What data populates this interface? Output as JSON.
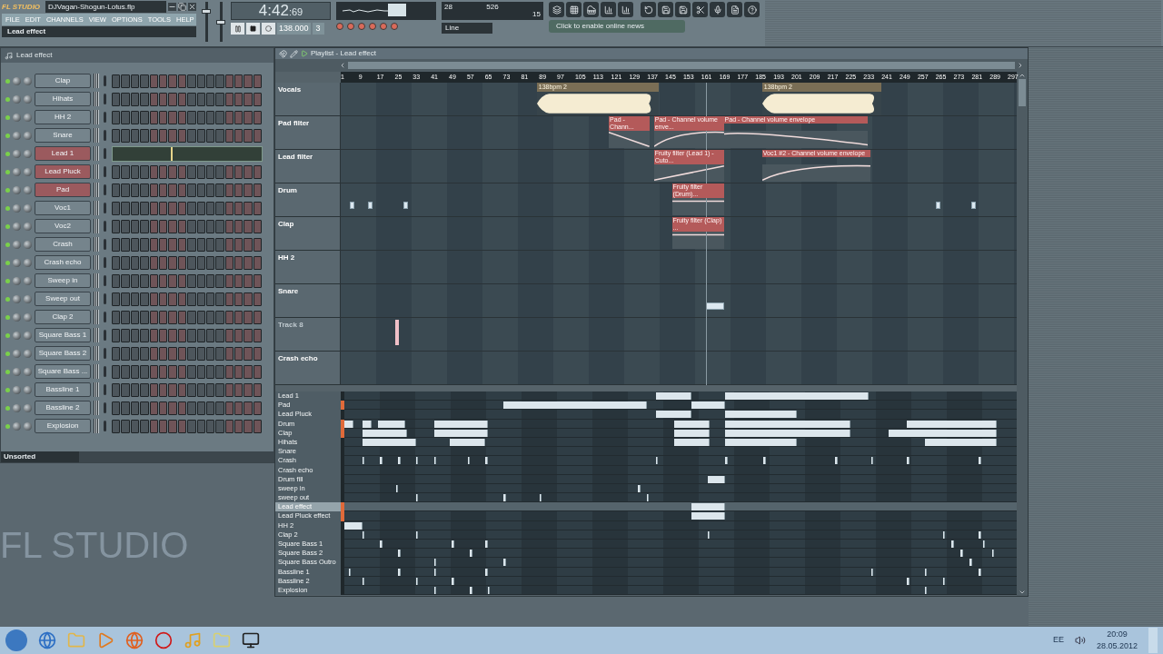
{
  "app": {
    "logo": "FL STUDIO",
    "file_name": "DJVagan-Shogun-Lotus.flp",
    "menu": [
      "FILE",
      "EDIT",
      "CHANNELS",
      "VIEW",
      "OPTIONS",
      "TOOLS",
      "HELP"
    ],
    "hint": "Lead effect",
    "time": "4:42",
    "time_frac": ":69",
    "tempo": "138.000",
    "pattern": "3",
    "snap": "Line",
    "cpu": "28",
    "memory": "526",
    "polyphony": "15",
    "news": "Click to enable online news",
    "master_volume": {
      "level": 0.8
    },
    "master_pitch": {
      "level": 0.5
    }
  },
  "channel_rack": {
    "title": "Lead effect",
    "filter": "Unsorted",
    "channels": [
      {
        "name": "Clap",
        "selected": false,
        "kind": "steps"
      },
      {
        "name": "Hihats",
        "selected": false,
        "kind": "steps"
      },
      {
        "name": "HH 2",
        "selected": false,
        "kind": "steps"
      },
      {
        "name": "Snare",
        "selected": false,
        "kind": "steps"
      },
      {
        "name": "Lead 1",
        "selected": true,
        "kind": "pianoroll"
      },
      {
        "name": "Lead Pluck",
        "selected": true,
        "kind": "steps"
      },
      {
        "name": "Pad",
        "selected": true,
        "kind": "steps"
      },
      {
        "name": "Voc1",
        "selected": false,
        "kind": "steps"
      },
      {
        "name": "Voc2",
        "selected": false,
        "kind": "steps"
      },
      {
        "name": "Crash",
        "selected": false,
        "kind": "steps"
      },
      {
        "name": "Crash echo",
        "selected": false,
        "kind": "steps"
      },
      {
        "name": "Sweep in",
        "selected": false,
        "kind": "steps"
      },
      {
        "name": "Sweep out",
        "selected": false,
        "kind": "steps"
      },
      {
        "name": "Clap 2",
        "selected": false,
        "kind": "steps"
      },
      {
        "name": "Square Bass 1",
        "selected": false,
        "kind": "steps"
      },
      {
        "name": "Square Bass 2",
        "selected": false,
        "kind": "steps"
      },
      {
        "name": "Square Bass ...",
        "selected": false,
        "kind": "steps"
      },
      {
        "name": "Bassline 1",
        "selected": false,
        "kind": "steps"
      },
      {
        "name": "Bassline 2",
        "selected": false,
        "kind": "steps"
      },
      {
        "name": "Explosion",
        "selected": false,
        "kind": "steps"
      }
    ]
  },
  "background_logo": "FL STUDIO",
  "playlist": {
    "title": "Playlist - Lead effect",
    "ruler": [
      "1",
      "9",
      "17",
      "25",
      "33",
      "41",
      "49",
      "57",
      "65",
      "73",
      "81",
      "89",
      "97",
      "105",
      "113",
      "121",
      "129",
      "137",
      "145",
      "153",
      "161",
      "169",
      "177",
      "185",
      "193",
      "201",
      "209",
      "217",
      "225",
      "233",
      "241",
      "249",
      "257",
      "265",
      "273",
      "281",
      "289",
      "297"
    ],
    "tracks": [
      {
        "name": "Vocals",
        "dimmed": false,
        "clips": [
          {
            "kind": "audio",
            "label": "138bpm 2"
          },
          {
            "kind": "audio",
            "label": "138bpm 2"
          }
        ]
      },
      {
        "name": "Pad filter",
        "dimmed": false,
        "clips": [
          {
            "kind": "automation",
            "label": "Pad - Chann..."
          },
          {
            "kind": "automation",
            "label": "Pad - Channel volume enve..."
          },
          {
            "kind": "automation",
            "label": "Pad - Channel volume envelope"
          }
        ]
      },
      {
        "name": "Lead filter",
        "dimmed": false,
        "clips": [
          {
            "kind": "automation",
            "label": "Fruity filter (Lead 1) - Cuto..."
          },
          {
            "kind": "automation",
            "label": "Voc1 #2 - Channel volume envelope"
          }
        ]
      },
      {
        "name": "Drum",
        "dimmed": false,
        "clips": [
          {
            "kind": "pattern"
          },
          {
            "kind": "pattern"
          },
          {
            "kind": "pattern"
          },
          {
            "kind": "automation",
            "label": "Fruity filter (Drum)..."
          },
          {
            "kind": "pattern"
          },
          {
            "kind": "pattern"
          }
        ]
      },
      {
        "name": "Clap",
        "dimmed": false,
        "clips": [
          {
            "kind": "automation",
            "label": "Fruity filter (Clap) ..."
          }
        ]
      },
      {
        "name": "HH 2",
        "dimmed": false
      },
      {
        "name": "Snare",
        "dimmed": false,
        "clips": [
          {
            "kind": "pattern"
          }
        ]
      },
      {
        "name": "Track 8",
        "dimmed": true,
        "clips": [
          {
            "kind": "note"
          }
        ]
      },
      {
        "name": "Crash echo",
        "dimmed": false
      }
    ],
    "patterns": [
      {
        "name": "Lead 1",
        "selected": false,
        "marked": false
      },
      {
        "name": "Pad",
        "selected": false,
        "marked": true
      },
      {
        "name": "Lead Pluck",
        "selected": false,
        "marked": false
      },
      {
        "name": "Drum",
        "selected": false,
        "marked": true
      },
      {
        "name": "Clap",
        "selected": false,
        "marked": true
      },
      {
        "name": "Hihats",
        "selected": false,
        "marked": false
      },
      {
        "name": "Snare",
        "selected": false,
        "marked": false
      },
      {
        "name": "Crash",
        "selected": false,
        "marked": false
      },
      {
        "name": "Crash echo",
        "selected": false,
        "marked": false
      },
      {
        "name": "Drum fill",
        "selected": false,
        "marked": false
      },
      {
        "name": "sweep in",
        "selected": false,
        "marked": false
      },
      {
        "name": "sweep out",
        "selected": false,
        "marked": false
      },
      {
        "name": "Lead effect",
        "selected": true,
        "marked": true
      },
      {
        "name": "Lead Pluck effect",
        "selected": false,
        "marked": true
      },
      {
        "name": "HH 2",
        "selected": false,
        "marked": false
      },
      {
        "name": "Clap 2",
        "selected": false,
        "marked": false
      },
      {
        "name": "Square Bass 1",
        "selected": false,
        "marked": false
      },
      {
        "name": "Square Bass 2",
        "selected": false,
        "marked": false
      },
      {
        "name": "Square Bass Outro",
        "selected": false,
        "marked": false
      },
      {
        "name": "Bassline 1",
        "selected": false,
        "marked": false
      },
      {
        "name": "Bassline 2",
        "selected": false,
        "marked": false
      },
      {
        "name": "Explosion",
        "selected": false,
        "marked": false
      }
    ]
  },
  "taskbar": {
    "language": "EE",
    "time": "20:09",
    "date": "28.05.2012"
  }
}
